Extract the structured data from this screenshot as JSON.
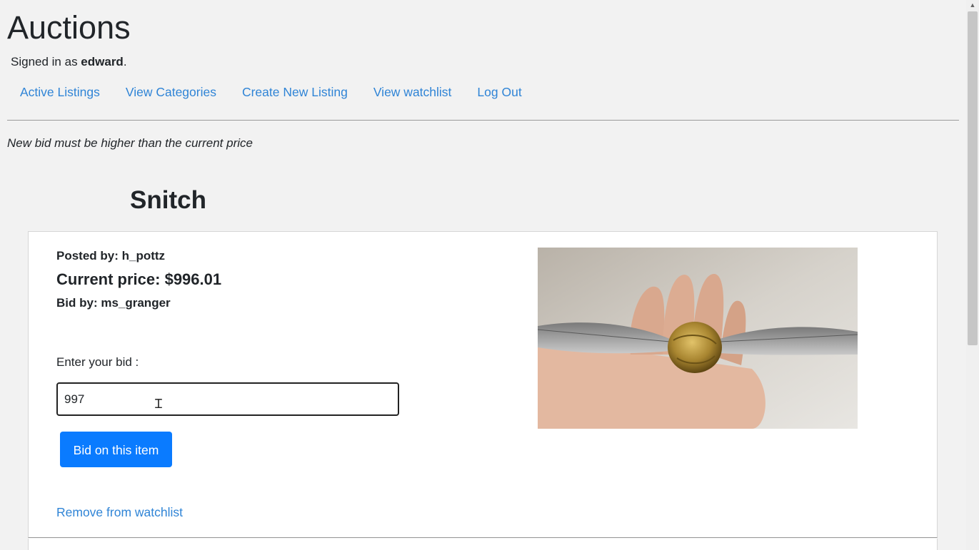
{
  "header": {
    "site_title": "Auctions",
    "signed_in_prefix": "Signed in as ",
    "username": "edward",
    "signed_in_suffix": "."
  },
  "nav": {
    "items": [
      {
        "label": "Active Listings"
      },
      {
        "label": "View Categories"
      },
      {
        "label": "Create New Listing"
      },
      {
        "label": "View watchlist"
      },
      {
        "label": "Log Out"
      }
    ]
  },
  "flash_message": "New bid must be higher than the current price",
  "listing": {
    "title": "Snitch",
    "posted_by": "Posted by: h_pottz",
    "current_price": "Current price: $996.01",
    "bid_by": "Bid by: ms_granger",
    "bid_label": "Enter your bid :",
    "bid_value": "997",
    "bid_button": "Bid on this item",
    "watchlist_link": "Remove from watchlist",
    "image_alt": "golden-snitch-photo"
  }
}
